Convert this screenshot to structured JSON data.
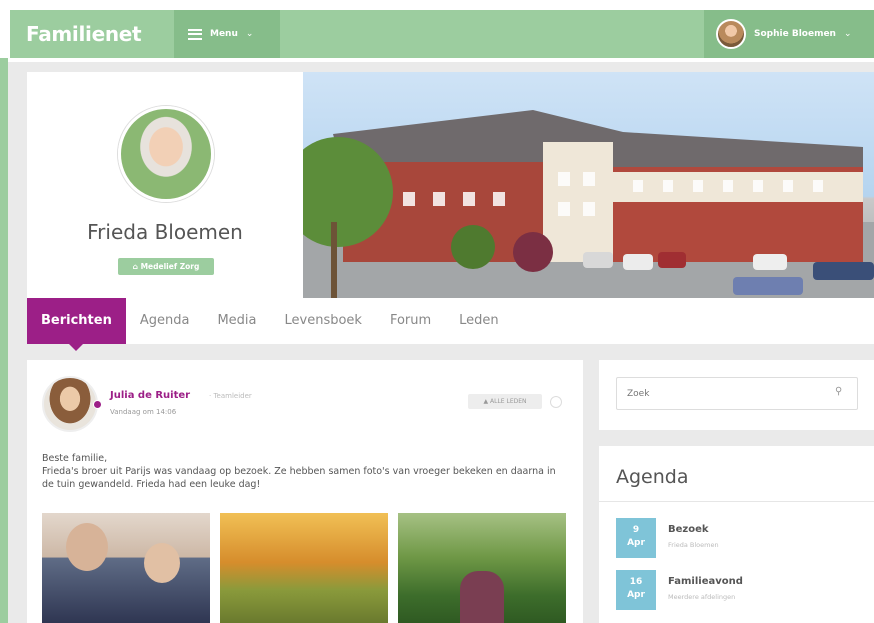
{
  "header": {
    "brand": "Familienet",
    "menu_label": "Menu",
    "user_name": "Sophie Bloemen"
  },
  "profile": {
    "name": "Frieda Bloemen",
    "organization": "Medelief Zorg"
  },
  "tabs": [
    {
      "label": "Berichten",
      "active": true
    },
    {
      "label": "Agenda"
    },
    {
      "label": "Media"
    },
    {
      "label": "Levensboek"
    },
    {
      "label": "Forum"
    },
    {
      "label": "Leden"
    }
  ],
  "post": {
    "author": "Julia de Ruiter",
    "role": "Teamleider",
    "time": "Vandaag om 14:06",
    "audience": "ALLE LEDEN",
    "body_line1": "Beste familie,",
    "body_line2": "Frieda's broer uit Parijs was vandaag op bezoek. Ze hebben samen foto's van vroeger bekeken en daarna in de tuin gewandeld. Frieda had een leuke dag!"
  },
  "search": {
    "placeholder": "Zoek"
  },
  "agenda": {
    "title": "Agenda",
    "items": [
      {
        "day": "9",
        "month": "Apr",
        "title": "Bezoek",
        "subtitle": "Frieda Bloemen"
      },
      {
        "day": "16",
        "month": "Apr",
        "title": "Familieavond",
        "subtitle": "Meerdere afdelingen"
      }
    ]
  },
  "colors": {
    "brand_green": "#9ccd9f",
    "accent_purple": "#9c1f87",
    "date_blue": "#7fc4d8"
  }
}
